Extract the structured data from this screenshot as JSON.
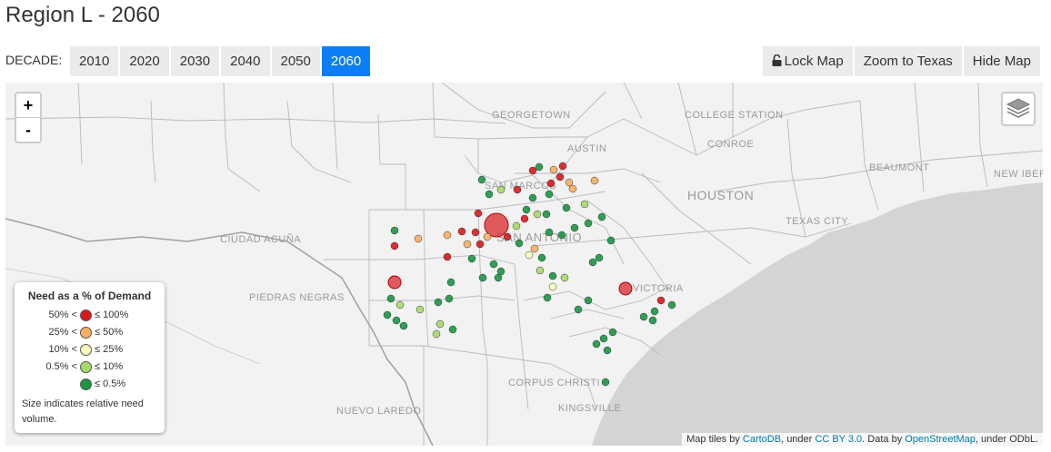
{
  "title": "Region L - 2060",
  "decade_label": "DECADE:",
  "decades": [
    "2010",
    "2020",
    "2030",
    "2040",
    "2050",
    "2060"
  ],
  "selected_decade": "2060",
  "actions": {
    "lock": "Lock Map",
    "zoom": "Zoom to Texas",
    "hide": "Hide Map"
  },
  "zoom": {
    "in": "+",
    "out": "-"
  },
  "legend": {
    "title": "Need as a % of Demand",
    "rows": [
      {
        "low": "50% <",
        "high": "≤ 100%",
        "color": "#d7191c"
      },
      {
        "low": "25% <",
        "high": "≤ 50%",
        "color": "#fdae61"
      },
      {
        "low": "10% <",
        "high": "≤ 25%",
        "color": "#ffffbf"
      },
      {
        "low": "0.5% <",
        "high": "≤ 10%",
        "color": "#a6d96a"
      },
      {
        "low": "",
        "high": "≤ 0.5%",
        "color": "#1a9641"
      }
    ],
    "note": "Size indicates relative need volume."
  },
  "attribution": {
    "p1": "Map tiles by ",
    "l1": "CartoDB",
    "p2": ", under ",
    "l2": "CC BY 3.0",
    "p3": ". Data by ",
    "l3": "OpenStreetMap",
    "p4": ", under ODbL."
  },
  "cities": [
    "GEORGETOWN",
    "COLLEGE STATION",
    "AUSTIN",
    "CONROE",
    "BEAUMONT",
    "SAN MARCOS",
    "NEW IBERI",
    "HOUSTON",
    "CIUDAD ACUÑA",
    "PIEDRAS NEGRAS",
    "VICTORIA",
    "CORPUS CHRISTI",
    "NUEVO LAREDO",
    "KINGSVILLE",
    "SAN ANTONIO",
    "TEXAS CITY"
  ]
}
